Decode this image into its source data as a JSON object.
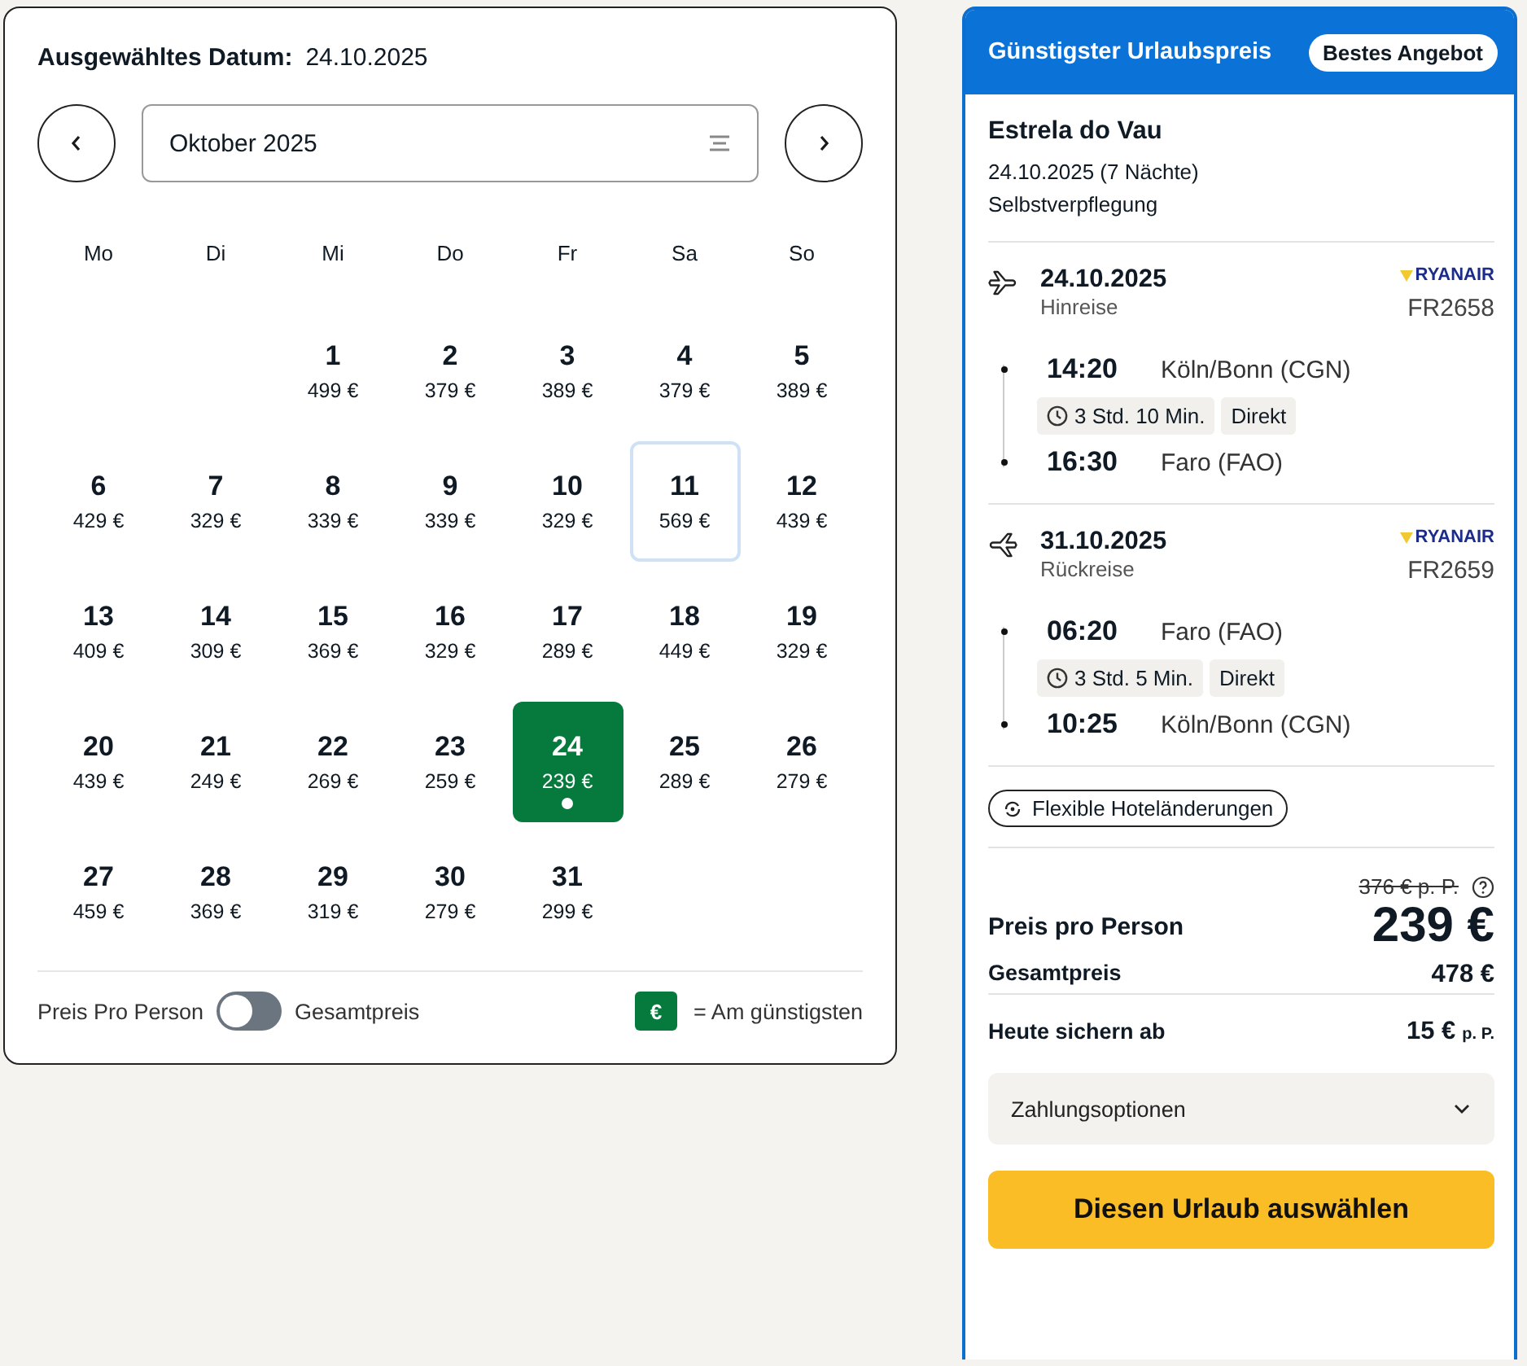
{
  "calendar": {
    "selected_label": "Ausgewähltes Datum:",
    "selected_date": "24.10.2025",
    "month": "Oktober 2025",
    "weekdays": [
      "Mo",
      "Di",
      "Mi",
      "Do",
      "Fr",
      "Sa",
      "So"
    ],
    "days": [
      {
        "kind": "blank"
      },
      {
        "kind": "blank"
      },
      {
        "kind": "day",
        "day": "1",
        "price": "499 €",
        "selected": false,
        "cheapest": false,
        "outlined": false
      },
      {
        "kind": "day",
        "day": "2",
        "price": "379 €",
        "selected": false,
        "cheapest": false,
        "outlined": false
      },
      {
        "kind": "day",
        "day": "3",
        "price": "389 €",
        "selected": false,
        "cheapest": false,
        "outlined": false
      },
      {
        "kind": "day",
        "day": "4",
        "price": "379 €",
        "selected": false,
        "cheapest": false,
        "outlined": false
      },
      {
        "kind": "day",
        "day": "5",
        "price": "389 €",
        "selected": false,
        "cheapest": false,
        "outlined": false
      },
      {
        "kind": "day",
        "day": "6",
        "price": "429 €",
        "selected": false,
        "cheapest": false,
        "outlined": false
      },
      {
        "kind": "day",
        "day": "7",
        "price": "329 €",
        "selected": false,
        "cheapest": false,
        "outlined": false
      },
      {
        "kind": "day",
        "day": "8",
        "price": "339 €",
        "selected": false,
        "cheapest": false,
        "outlined": false
      },
      {
        "kind": "day",
        "day": "9",
        "price": "339 €",
        "selected": false,
        "cheapest": false,
        "outlined": false
      },
      {
        "kind": "day",
        "day": "10",
        "price": "329 €",
        "selected": false,
        "cheapest": false,
        "outlined": false
      },
      {
        "kind": "day",
        "day": "11",
        "price": "569 €",
        "selected": false,
        "cheapest": false,
        "outlined": true
      },
      {
        "kind": "day",
        "day": "12",
        "price": "439 €",
        "selected": false,
        "cheapest": false,
        "outlined": false
      },
      {
        "kind": "day",
        "day": "13",
        "price": "409 €",
        "selected": false,
        "cheapest": false,
        "outlined": false
      },
      {
        "kind": "day",
        "day": "14",
        "price": "309 €",
        "selected": false,
        "cheapest": false,
        "outlined": false
      },
      {
        "kind": "day",
        "day": "15",
        "price": "369 €",
        "selected": false,
        "cheapest": false,
        "outlined": false
      },
      {
        "kind": "day",
        "day": "16",
        "price": "329 €",
        "selected": false,
        "cheapest": false,
        "outlined": false
      },
      {
        "kind": "day",
        "day": "17",
        "price": "289 €",
        "selected": false,
        "cheapest": false,
        "outlined": false
      },
      {
        "kind": "day",
        "day": "18",
        "price": "449 €",
        "selected": false,
        "cheapest": false,
        "outlined": false
      },
      {
        "kind": "day",
        "day": "19",
        "price": "329 €",
        "selected": false,
        "cheapest": false,
        "outlined": false
      },
      {
        "kind": "day",
        "day": "20",
        "price": "439 €",
        "selected": false,
        "cheapest": false,
        "outlined": false
      },
      {
        "kind": "day",
        "day": "21",
        "price": "249 €",
        "selected": false,
        "cheapest": false,
        "outlined": false
      },
      {
        "kind": "day",
        "day": "22",
        "price": "269 €",
        "selected": false,
        "cheapest": false,
        "outlined": false
      },
      {
        "kind": "day",
        "day": "23",
        "price": "259 €",
        "selected": false,
        "cheapest": false,
        "outlined": false
      },
      {
        "kind": "day",
        "day": "24",
        "price": "239 €",
        "selected": true,
        "cheapest": true,
        "outlined": false
      },
      {
        "kind": "day",
        "day": "25",
        "price": "289 €",
        "selected": false,
        "cheapest": false,
        "outlined": false
      },
      {
        "kind": "day",
        "day": "26",
        "price": "279 €",
        "selected": false,
        "cheapest": false,
        "outlined": false
      },
      {
        "kind": "day",
        "day": "27",
        "price": "459 €",
        "selected": false,
        "cheapest": false,
        "outlined": false
      },
      {
        "kind": "day",
        "day": "28",
        "price": "369 €",
        "selected": false,
        "cheapest": false,
        "outlined": false
      },
      {
        "kind": "day",
        "day": "29",
        "price": "319 €",
        "selected": false,
        "cheapest": false,
        "outlined": false
      },
      {
        "kind": "day",
        "day": "30",
        "price": "279 €",
        "selected": false,
        "cheapest": false,
        "outlined": false
      },
      {
        "kind": "day",
        "day": "31",
        "price": "299 €",
        "selected": false,
        "cheapest": false,
        "outlined": false
      }
    ],
    "toggle": {
      "left_label": "Preis Pro Person",
      "right_label": "Gesamtpreis",
      "on": false
    },
    "legend": {
      "symbol": "€",
      "text": "= Am günstigsten"
    }
  },
  "offer": {
    "title": "Günstigster Urlaubspreis",
    "badge": "Bestes Angebot",
    "hotel": "Estrela do Vau",
    "dates": "24.10.2025 (7 Nächte)",
    "board": "Selbstverpflegung",
    "flights": [
      {
        "kind": "outbound",
        "date": "24.10.2025",
        "direction": "Hinreise",
        "airline": "RYANAIR",
        "flight_no": "FR2658",
        "dep_time": "14:20",
        "dep_airport": "Köln/Bonn (CGN)",
        "duration": "3 Std. 10 Min.",
        "stops": "Direkt",
        "arr_time": "16:30",
        "arr_airport": "Faro (FAO)"
      },
      {
        "kind": "return",
        "date": "31.10.2025",
        "direction": "Rückreise",
        "airline": "RYANAIR",
        "flight_no": "FR2659",
        "dep_time": "06:20",
        "dep_airport": "Faro (FAO)",
        "duration": "3 Std. 5 Min.",
        "stops": "Direkt",
        "arr_time": "10:25",
        "arr_airport": "Köln/Bonn (CGN)"
      }
    ],
    "flex": "Flexible Hoteländerungen",
    "old_price": "376 € p. P.",
    "price_label": "Preis pro Person",
    "price": "239 €",
    "total_label": "Gesamtpreis",
    "total": "478 €",
    "deposit_label": "Heute sichern ab",
    "deposit": "15 €",
    "deposit_unit": "p. P.",
    "payment": "Zahlungsoptionen",
    "cta": "Diesen Urlaub auswählen"
  }
}
